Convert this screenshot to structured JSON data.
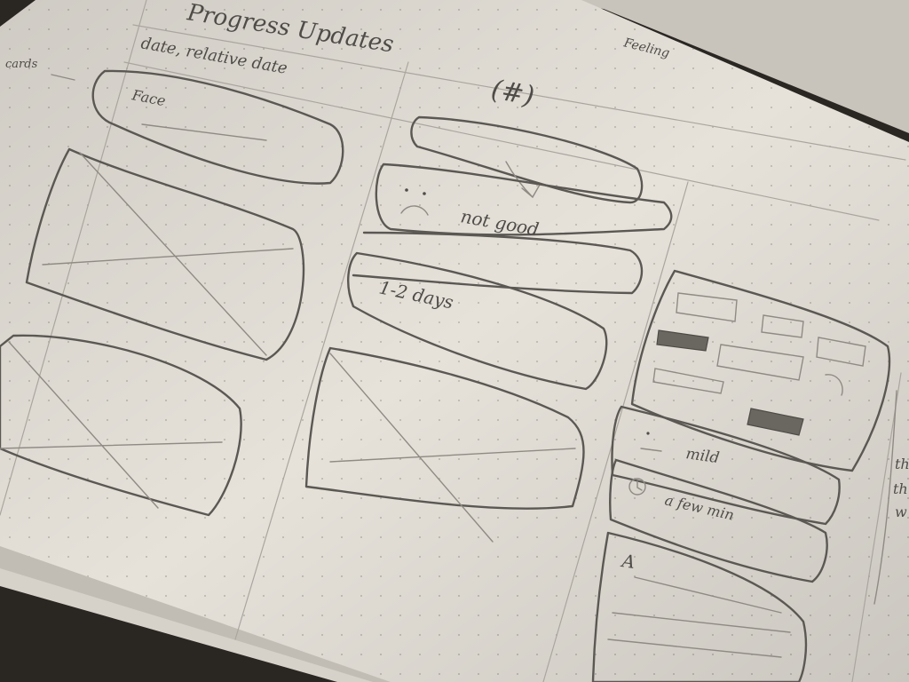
{
  "heading": "Progress Updates",
  "top_right_note": "Feeling",
  "left_margin_note": "cards",
  "column1": {
    "subheading": "date, relative date",
    "card1_label": "Face"
  },
  "column2": {
    "count_label": "(#)",
    "card_mood_label": "not good",
    "card_days_label": "1-2 days"
  },
  "column3": {
    "card_mood_label": "mild",
    "card_time_label": "a few min",
    "card_text_label": "A"
  },
  "right_edge_note": [
    "th",
    "th",
    "w"
  ],
  "colors": {
    "paper": "#e6e2da",
    "pencil": "#5b5853",
    "background": "#2a2622"
  }
}
